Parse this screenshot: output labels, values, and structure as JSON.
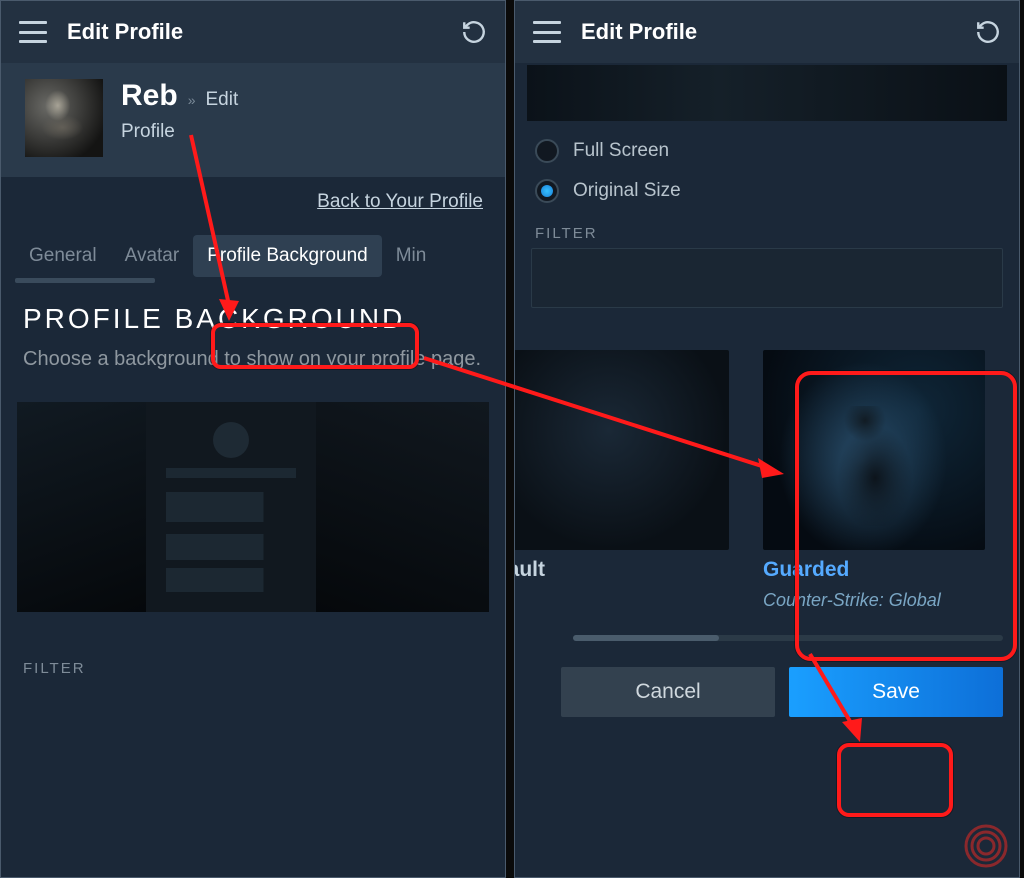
{
  "left": {
    "header": {
      "title": "Edit Profile"
    },
    "profile": {
      "username": "Reb",
      "editArrow": "»",
      "editText": "Edit",
      "crumb": "Profile"
    },
    "backLink": "Back to Your Profile",
    "tabs": {
      "general": "General",
      "avatar": "Avatar",
      "profileBackground": "Profile Background",
      "min": "Min"
    },
    "section": {
      "heading": "PROFILE BACKGROUND",
      "sub": "Choose a background to show on your profile page."
    },
    "filterLabel": "FILTER"
  },
  "right": {
    "header": {
      "title": "Edit Profile"
    },
    "sizeOptions": {
      "fullScreen": "Full Screen",
      "originalSize": "Original Size",
      "selected": "originalSize"
    },
    "filterLabel": "FILTER",
    "options": {
      "default": {
        "label": "efault"
      },
      "guarded": {
        "label": "Guarded",
        "sub": "Counter-Strike: Global"
      }
    },
    "buttons": {
      "cancel": "Cancel",
      "save": "Save"
    }
  }
}
